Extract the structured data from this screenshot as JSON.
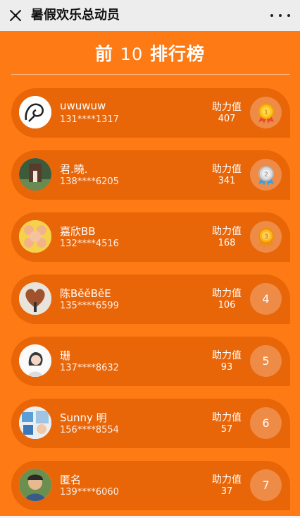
{
  "topbar": {
    "title": "暑假欢乐总动员",
    "close_icon": "close-icon",
    "more_icon": "more-icon"
  },
  "heading": {
    "prefix": "前",
    "number": "10",
    "suffix": "排行榜"
  },
  "score_label": "助力值",
  "entries": [
    {
      "name": "uwuwuw",
      "phone": "131****1317",
      "score": "407",
      "rank": "1",
      "medal": "gold-medal-icon"
    },
    {
      "name": "君.曉.",
      "phone": "138****6205",
      "score": "341",
      "rank": "2",
      "medal": "silver-medal-icon"
    },
    {
      "name": "嘉欣BB",
      "phone": "132****4516",
      "score": "168",
      "rank": "3",
      "medal": "bronze-medal-icon"
    },
    {
      "name": "陈BěěBěE",
      "phone": "135****6599",
      "score": "106",
      "rank": "4"
    },
    {
      "name": "珊",
      "phone": "137****8632",
      "score": "93",
      "rank": "5"
    },
    {
      "name": "Sunny 明",
      "phone": "156****8554",
      "score": "57",
      "rank": "6"
    },
    {
      "name": "匿名",
      "phone": "139****6060",
      "score": "37",
      "rank": "7"
    }
  ],
  "colors": {
    "background": "#fd7a14",
    "card": "#e86508",
    "text": "#ffffff"
  }
}
